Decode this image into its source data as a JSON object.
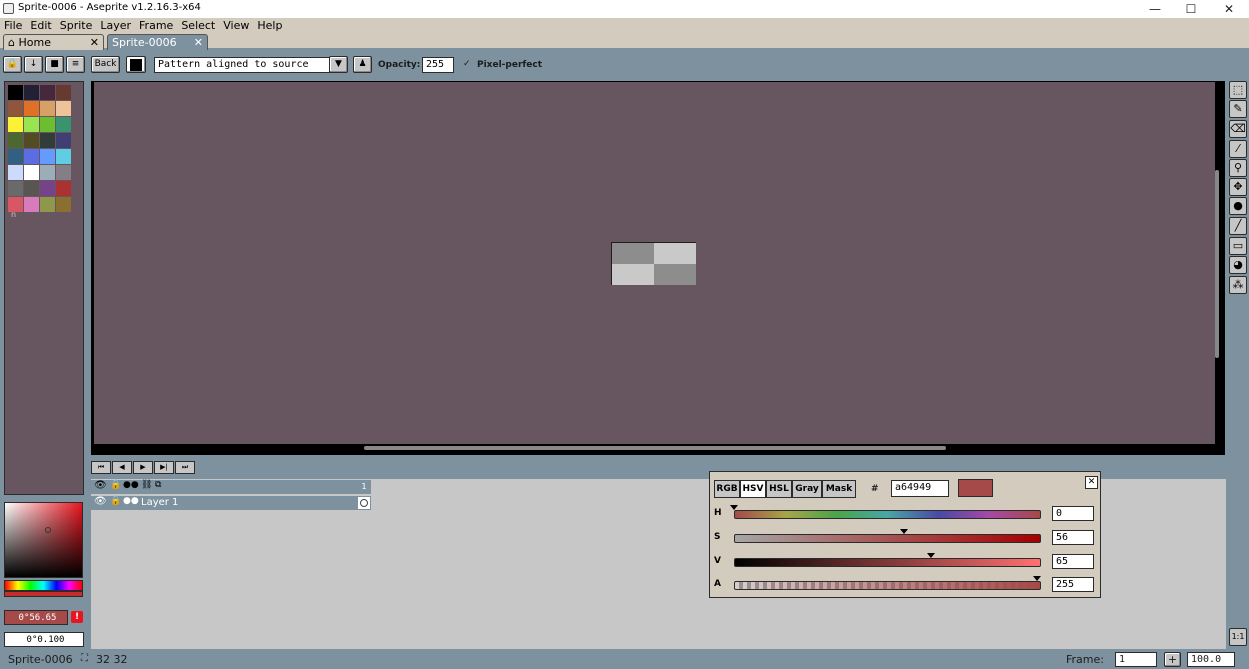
{
  "window": {
    "title": "Sprite-0006 - Aseprite v1.2.16.3-x64",
    "minimize": "—",
    "maximize": "☐",
    "close": "✕"
  },
  "menu": [
    "File",
    "Edit",
    "Sprite",
    "Layer",
    "Frame",
    "Select",
    "View",
    "Help"
  ],
  "tabs": [
    {
      "label": "Home",
      "close": "✕",
      "icon": "home-icon"
    },
    {
      "label": "Sprite-0006",
      "close": "✕"
    }
  ],
  "context": {
    "back_label": "Back",
    "pattern_value": "Pattern aligned to source",
    "opacity_label": "Opacity:",
    "opacity_value": "255",
    "pixel_perfect_label": "Pixel-perfect",
    "pixel_perfect_checked": "✓"
  },
  "palette": {
    "colors": [
      "#000000",
      "#222034",
      "#45283c",
      "#663931",
      "#8f563b",
      "#df7126",
      "#d9a066",
      "#eec39a",
      "#fbf236",
      "#99e550",
      "#6abe30",
      "#37946e",
      "#4b692f",
      "#524b24",
      "#323c39",
      "#3f3f74",
      "#306082",
      "#5b6ee1",
      "#639bff",
      "#5fcde4",
      "#cbdbfc",
      "#ffffff",
      "#9badb7",
      "#847e87",
      "#696a6a",
      "#595652",
      "#76428a",
      "#ac3232",
      "#d95763",
      "#d77bba",
      "#8f974a",
      "#8a6f30"
    ],
    "index_label": "n"
  },
  "color_selector": {
    "fg_value": "0°56.65",
    "bg_value": "0°0.100",
    "warning": "!"
  },
  "timeline": {
    "frame_number": "1",
    "layer_name": "Layer 1",
    "anim_buttons": [
      "⏮",
      "◀",
      "▶",
      "▶|",
      "⏭"
    ]
  },
  "color_popup": {
    "tabs": [
      "RGB",
      "HSV",
      "HSL",
      "Gray",
      "Mask"
    ],
    "active_tab": "HSV",
    "hash": "#",
    "hex_value": "a64949",
    "swatch_color": "#a64949",
    "close": "✕",
    "sliders": [
      {
        "label": "H",
        "value": "0",
        "marker": 0.0
      },
      {
        "label": "S",
        "value": "56",
        "marker": 0.56
      },
      {
        "label": "V",
        "value": "65",
        "marker": 0.65
      },
      {
        "label": "A",
        "value": "255",
        "marker": 1.0
      }
    ]
  },
  "status": {
    "sprite_name": "Sprite-0006",
    "size": "32 32",
    "frame_label": "Frame:",
    "frame_value": "1",
    "add_frame": "+",
    "zoom_value": "100.0"
  },
  "tools": [
    "marquee-icon",
    "pencil-icon",
    "eraser-icon",
    "eyedropper-icon",
    "zoom-icon",
    "move-icon",
    "bucket-icon",
    "line-icon",
    "rectangle-icon",
    "ellipse-icon",
    "spray-icon"
  ]
}
